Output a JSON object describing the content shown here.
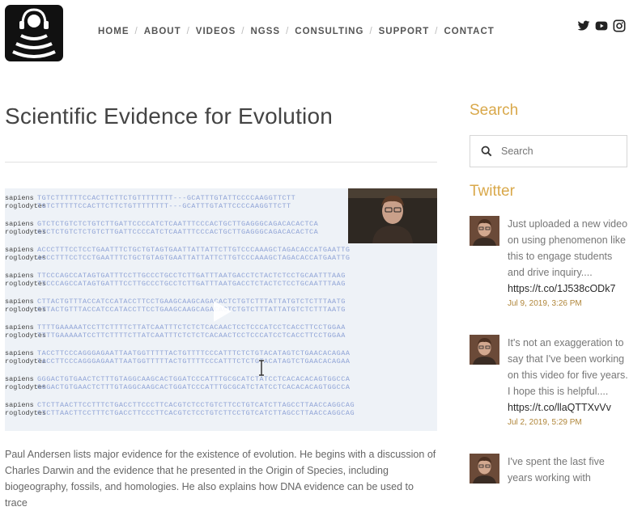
{
  "nav": {
    "items": [
      "HOME",
      "ABOUT",
      "VIDEOS",
      "NGSS",
      "CONSULTING",
      "SUPPORT",
      "CONTACT"
    ]
  },
  "social": {
    "icons": [
      "twitter-icon",
      "youtube-icon",
      "instagram-icon"
    ]
  },
  "article": {
    "title": "Scientific Evidence for Evolution",
    "description": "Paul Andersen lists major evidence for the existence of evolution. He begins with a discussion of Charles Darwin and the evidence that he presented in the Origin of Species, including biogeography, fossils, and homologies. He also explains how DNA evidence can be used to trace"
  },
  "video": {
    "rows": [
      {
        "label": "sapiens",
        "seq": "TGTCTTTTTTCCACTTCTTCTGTTTTTTTT---GCATTTGTATTCCCCAAGGTTCTT"
      },
      {
        "label": "roglodytes",
        "seq": "TGTCTTTTTCCACTTCTTCTGTTTTTTTT---GCATTTGTATTCCCCAAGGTTCTT"
      },
      {
        "label": "sapiens",
        "seq": "GTCTCTGTCTCTGTCTTGATTCCCCATCTCAATTTCCCACTGCTTGAGGGCAGACACACTCA"
      },
      {
        "label": "roglodytes",
        "seq": "GTCTCTGTCTCTGTCTTGATTCCCCATCTCAATTTCCCACTGCTTGAGGGCAGACACACTCA"
      },
      {
        "label": "sapiens",
        "seq": "ACCCTTTCCTCCTGAATTTCTGCTGTAGTGAATTATTATTCTTGTCCCAAAGCTAGACACCATGAATTG"
      },
      {
        "label": "roglodytes",
        "seq": "ACCCTTTCCTCCTGAATTTCTGCTGTAGTGAATTATTATTCTTGTCCCAAAGCTAGACACCATGAATTG"
      },
      {
        "label": "sapiens",
        "seq": "TTCCCAGCCATAGTGATTTCCTTGCCCTGCCTCTTGATTTAATGACCTCTACTCTCCTGCAATTTAAG"
      },
      {
        "label": "roglodytes",
        "seq": "TTCCCAGCCATAGTGATTTCCTTGCCCTGCCTCTTGATTTAATGACCTCTACTCTCCTGCAATTTAAG"
      },
      {
        "label": "sapiens",
        "seq": "CTTACTGTTTACCATCCATACCTTCCTGAAGCAAGCAGACACTCTGTCTTTATTATGTCTCTTTAATG"
      },
      {
        "label": "roglodytes",
        "seq": "CTTACTGTTTACCATCCATACCTTCCTGAAGCAAGCAGACACTCTGTCTTTATTATGTCTCTTTAATG"
      },
      {
        "label": "sapiens",
        "seq": "TTTTGAAAAATCCTTCTTTTCTTATCAATTTCTCTCTCACAACTCCTCCCATCCTCACCTTCCTGGAA"
      },
      {
        "label": "roglodytes",
        "seq": "TTTTGAAAAATCCTTCTTTTCTTATCAATTTCTCTCTCACAACTCCTCCCATCCTCACCTTCCTGGAA"
      },
      {
        "label": "sapiens",
        "seq": "TACCTTCCCAGGGAGAATTAATGGTTTTTACTGTTTTCCCATTTCTCTGTACATAGTCTGAACACAGAA"
      },
      {
        "label": "roglodytes",
        "seq": "TACCTTCCCAGGGAGAATTAATGGTTTTTACTGTTTTCCCATTTCTCTGTACATAGTCTGAACACAGAA"
      },
      {
        "label": "sapiens",
        "seq": "GGGACTGTGAACTCTTTGTAGGCAAGCACTGGATCCCATTTGCGCATCTATCCTCACACACAGTGGCCA"
      },
      {
        "label": "roglodytes",
        "seq": "GGGACTGTGAACTCTTTGTAGGCAAGCACTGGATCCCATTTGCGCATCTATCCTCACACACAGTGGCCA"
      },
      {
        "label": "sapiens",
        "seq": "CTCTTAACTTCCTTTCTGACCTTCCCTTCACGTCTCCTGTCTTCCTGTCATCTTAGCCTTAACCAGGCAG"
      },
      {
        "label": "roglodytes",
        "seq": "CTCTTAACTTCCTTTCTGACCTTCCCTTCACGTCTCCTGTCTTCCTGTCATCTTAGCCTTAACCAGGCAG"
      }
    ]
  },
  "sidebar": {
    "search_heading": "Search",
    "search_placeholder": "Search",
    "twitter_heading": "Twitter",
    "tweets": [
      {
        "text": "Just uploaded a new video on using phenomenon like this to engage students and drive inquiry....",
        "link": "https://t.co/1J538cODk7",
        "date": "Jul 9, 2019, 3:26 PM"
      },
      {
        "text": "It's not an exaggeration to say that I've been working on this video for five years. I hope this is helpful....",
        "link": "https://t.co/llaQTTXvVv",
        "date": "Jul 2, 2019, 5:29 PM"
      },
      {
        "text": "I've spent the last five years working with",
        "link": "",
        "date": ""
      }
    ]
  },
  "colors": {
    "accent": "#d9a84a",
    "nav_text": "#555555",
    "body_text": "#666666"
  }
}
